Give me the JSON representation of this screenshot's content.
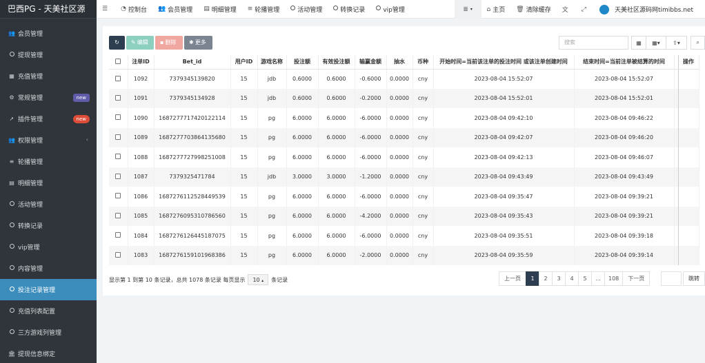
{
  "brand": "巴西PG - 天美社区源",
  "sidebar": {
    "items": [
      {
        "label": "会员管理",
        "icon": "users-icon"
      },
      {
        "label": "提现管理",
        "icon": "circle-icon"
      },
      {
        "label": "充值管理",
        "icon": "grid-icon"
      },
      {
        "label": "常规管理",
        "icon": "cogs-icon",
        "badge": "new"
      },
      {
        "label": "插件管理",
        "icon": "rocket-icon",
        "badge": "new"
      },
      {
        "label": "权限管理",
        "icon": "users-icon"
      },
      {
        "label": "轮播管理",
        "icon": "list-icon"
      },
      {
        "label": "明细管理",
        "icon": "calendar-icon"
      },
      {
        "label": "活动管理",
        "icon": "circle-icon"
      },
      {
        "label": "转换记录",
        "icon": "circle-icon"
      },
      {
        "label": "vip管理",
        "icon": "circle-icon"
      },
      {
        "label": "内容管理",
        "icon": "circle-icon"
      },
      {
        "label": "投注记录管理",
        "icon": "circle-icon"
      },
      {
        "label": "充值列表配置",
        "icon": "circle-icon"
      },
      {
        "label": "三方游戏列管理",
        "icon": "circle-icon"
      },
      {
        "label": "提现信息绑定",
        "icon": "bank-icon"
      }
    ]
  },
  "topbar": {
    "tabs": [
      {
        "label": "控制台",
        "icon": "dashboard-icon"
      },
      {
        "label": "会员管理",
        "icon": "users-icon"
      },
      {
        "label": "明细管理",
        "icon": "calendar-icon"
      },
      {
        "label": "轮播管理",
        "icon": "list-icon"
      },
      {
        "label": "活动管理",
        "icon": "circle-icon"
      },
      {
        "label": "转换记录",
        "icon": "circle-icon"
      },
      {
        "label": "vip管理",
        "icon": "circle-icon"
      }
    ],
    "home": "主页",
    "clear_cache": "清除缓存",
    "site_name": "天美社区源码网timibbs.net"
  },
  "toolbar": {
    "edit": "编辑",
    "delete": "删除",
    "more": "更多",
    "search_placeholder": "搜索"
  },
  "table": {
    "headers": [
      "注单ID",
      "Bet_id",
      "用户ID",
      "游戏名称",
      "投注额",
      "有效投注额",
      "输赢金额",
      "抽水",
      "币种",
      "开始时间=当前该注单的投注时间 或该注单创建时间",
      "结束时间=当前注单被结算的时间",
      "",
      "操作"
    ],
    "rows": [
      [
        "1092",
        "7379345139820",
        "15",
        "jdb",
        "0.6000",
        "0.6000",
        "-0.6000",
        "0.0000",
        "cny",
        "2023-08-04 15:52:07",
        "2023-08-04 15:52:07"
      ],
      [
        "1091",
        "7379345134928",
        "15",
        "jdb",
        "0.6000",
        "0.6000",
        "-0.2000",
        "0.0000",
        "cny",
        "2023-08-04 15:52:01",
        "2023-08-04 15:52:01"
      ],
      [
        "1090",
        "1687277717420122114",
        "15",
        "pg",
        "6.0000",
        "6.0000",
        "-6.0000",
        "0.0000",
        "cny",
        "2023-08-04 09:42:10",
        "2023-08-04 09:46:22"
      ],
      [
        "1089",
        "1687277703864135680",
        "15",
        "pg",
        "6.0000",
        "6.0000",
        "-6.0000",
        "0.0000",
        "cny",
        "2023-08-04 09:42:07",
        "2023-08-04 09:46:20"
      ],
      [
        "1088",
        "1687277727998251008",
        "15",
        "pg",
        "6.0000",
        "6.0000",
        "-6.0000",
        "0.0000",
        "cny",
        "2023-08-04 09:42:13",
        "2023-08-04 09:46:07"
      ],
      [
        "1087",
        "7379325471784",
        "15",
        "jdb",
        "3.0000",
        "3.0000",
        "-1.2000",
        "0.0000",
        "cny",
        "2023-08-04 09:43:49",
        "2023-08-04 09:43:49"
      ],
      [
        "1086",
        "1687276112528449539",
        "15",
        "pg",
        "6.0000",
        "6.0000",
        "-6.0000",
        "0.0000",
        "cny",
        "2023-08-04 09:35:47",
        "2023-08-04 09:39:21"
      ],
      [
        "1085",
        "1687276095310786560",
        "15",
        "pg",
        "6.0000",
        "6.0000",
        "-4.2000",
        "0.0000",
        "cny",
        "2023-08-04 09:35:43",
        "2023-08-04 09:39:21"
      ],
      [
        "1084",
        "1687276126445187075",
        "15",
        "pg",
        "6.0000",
        "6.0000",
        "-6.0000",
        "0.0000",
        "cny",
        "2023-08-04 09:35:51",
        "2023-08-04 09:39:18"
      ],
      [
        "1083",
        "1687276159101968386",
        "15",
        "pg",
        "6.0000",
        "6.0000",
        "-2.0000",
        "0.0000",
        "cny",
        "2023-08-04 09:35:59",
        "2023-08-04 09:39:14"
      ]
    ]
  },
  "footer": {
    "summary": "显示第 1 到第 10 条记录，总共 1078 条记录 每页显示",
    "per_page": "10",
    "per_page_suffix": "条记录",
    "pages": [
      "上一页",
      "1",
      "2",
      "3",
      "4",
      "5",
      "...",
      "108",
      "下一页"
    ],
    "active_page": "1",
    "jump": "跳转"
  },
  "colors": {
    "sidebar_bg": "#2f353a",
    "active": "#3c8dbc",
    "primary_dark": "#2c3e50"
  }
}
